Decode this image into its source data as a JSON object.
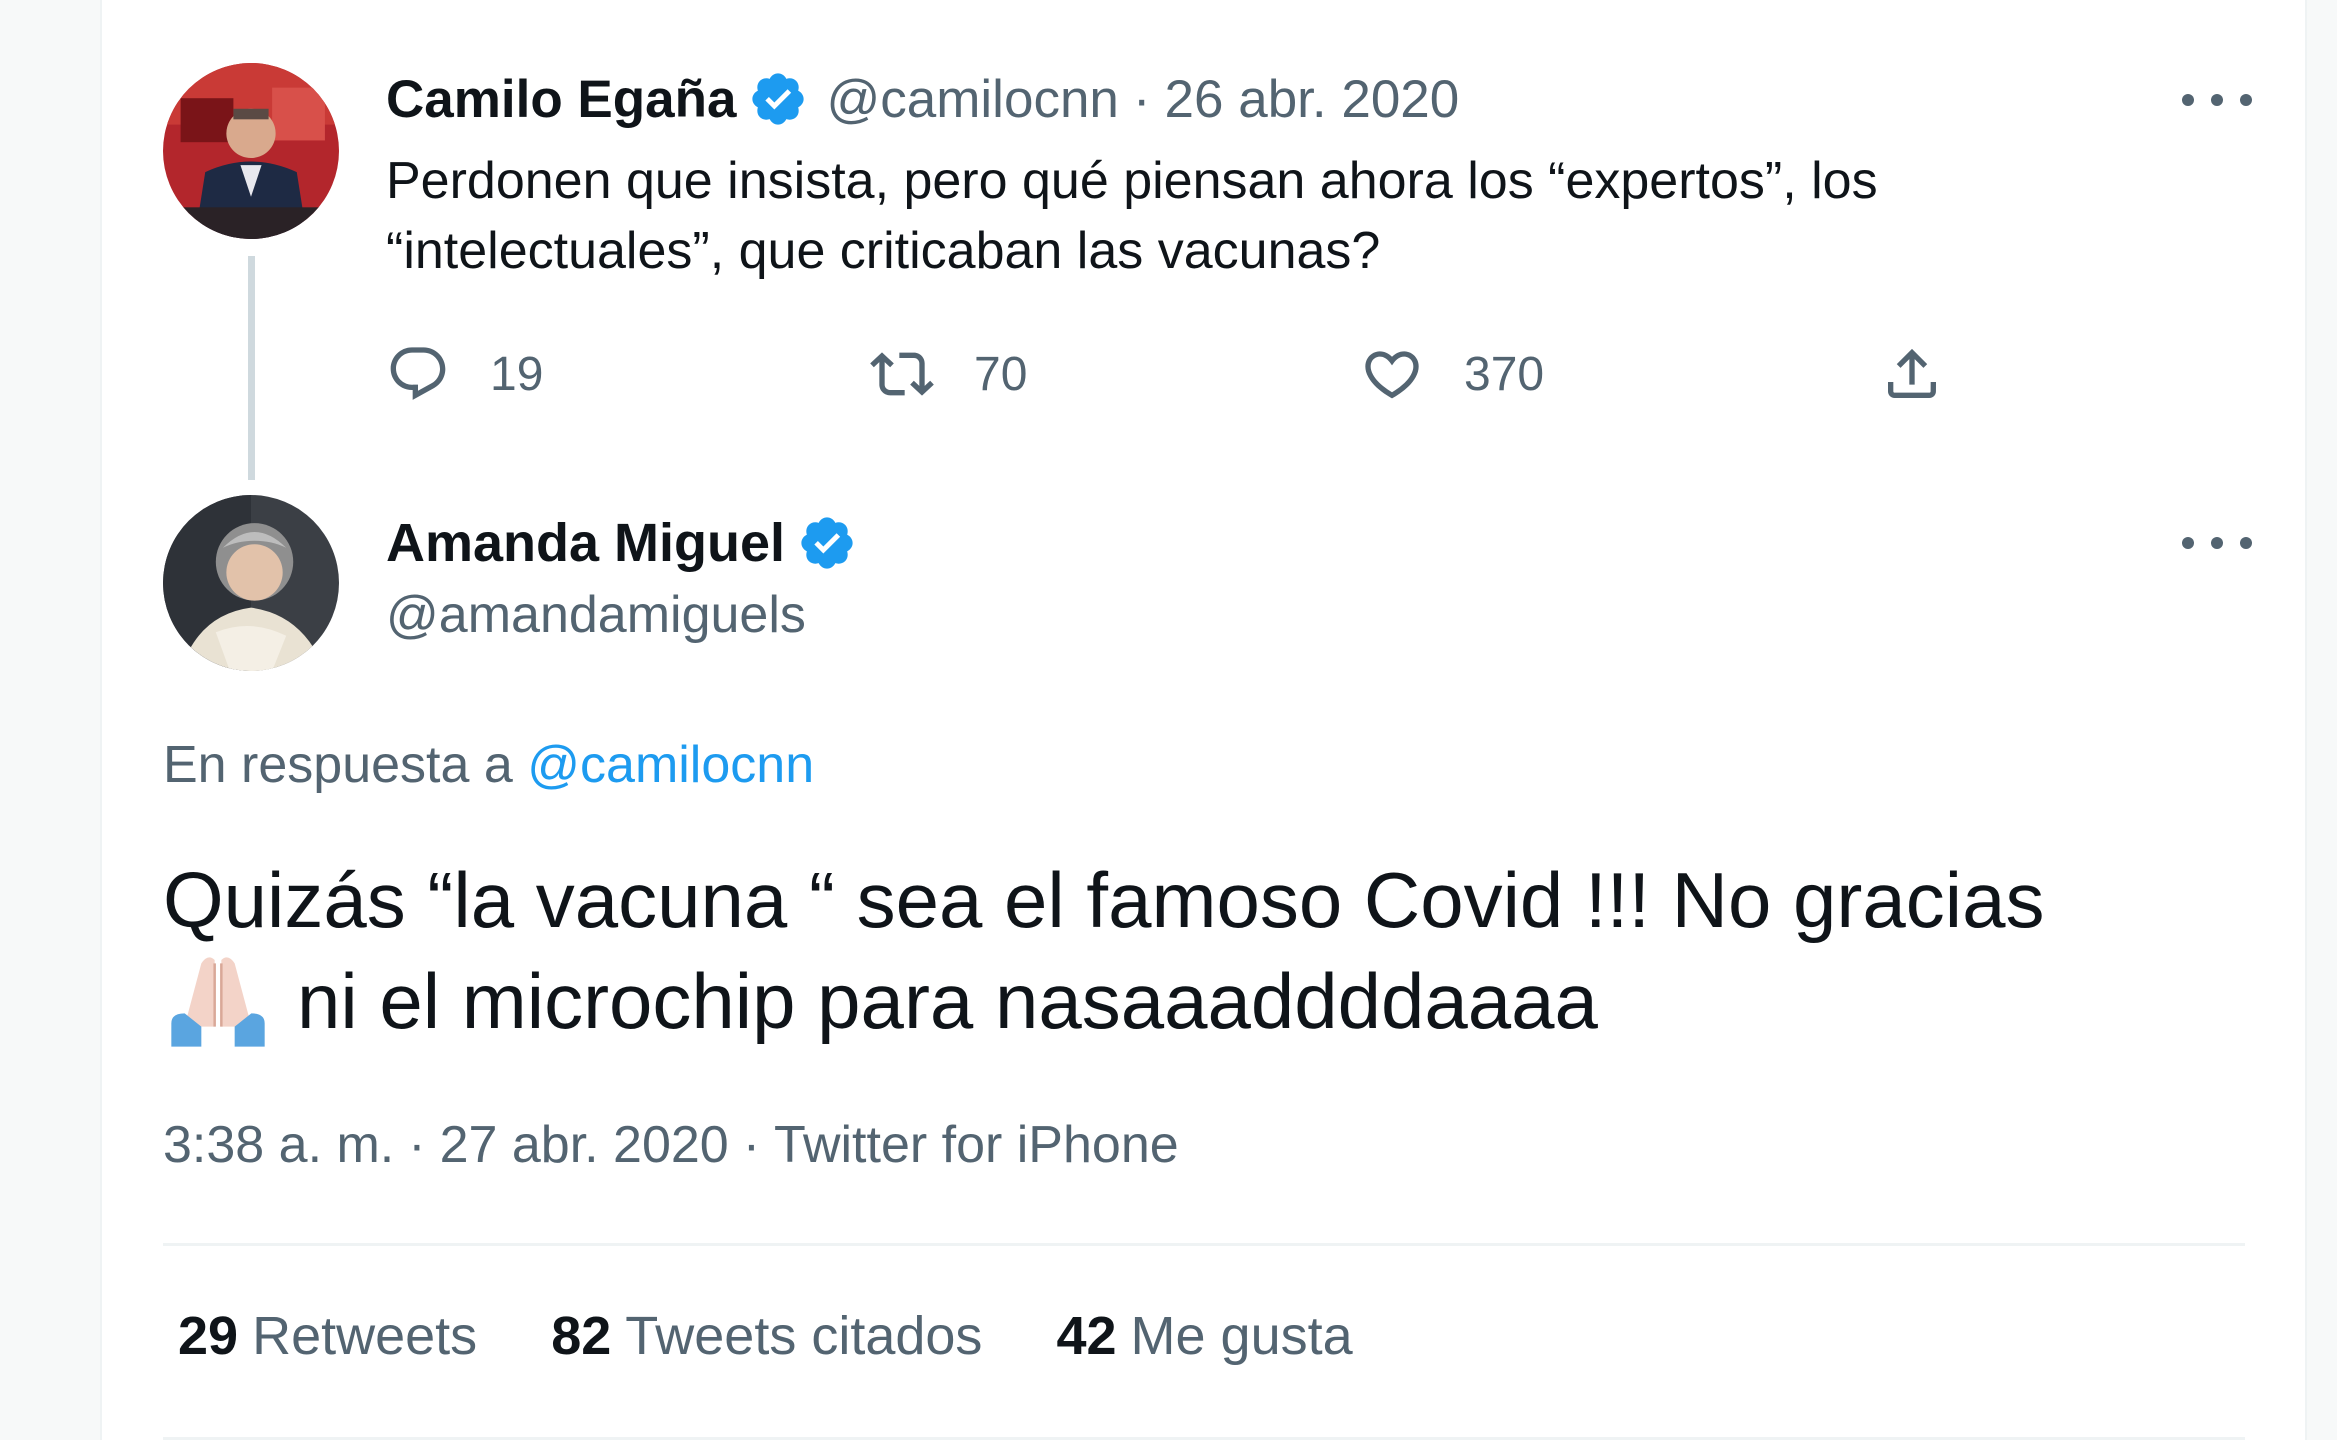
{
  "parent_tweet": {
    "author_name": "Camilo Egaña",
    "handle": "@camilocnn",
    "separator": "·",
    "date": "26 abr. 2020",
    "text": "Perdonen que insista, pero qué piensan ahora los “expertos”, los\n“intelectuales”, que criticaban las vacunas?",
    "actions": {
      "replies": "19",
      "retweets": "70",
      "likes": "370"
    }
  },
  "main_tweet": {
    "author_name": "Amanda Miguel",
    "handle": "@amandamiguels",
    "reply_prefix": "En respuesta a",
    "reply_mention": "@camilocnn",
    "text_line_1": "Quizás “la vacuna “ sea el famoso Covid !!! No gracias",
    "text_line_2": "ni el microchip para nasaaaddddaaaa",
    "emoji": "folded-hands-emoji",
    "time": "3:38 a. m.",
    "date": "27 abr. 2020",
    "source": "Twitter for iPhone",
    "separator": "·",
    "stats": {
      "retweets_count": "29",
      "retweets_label": "Retweets",
      "quotes_count": "82",
      "quotes_label": "Tweets citados",
      "likes_count": "42",
      "likes_label": "Me gusta"
    }
  },
  "colors": {
    "verified_blue": "#1d9bf0",
    "text_primary": "#0f1419",
    "text_secondary": "#536471",
    "mention": "#1d9bf0"
  }
}
